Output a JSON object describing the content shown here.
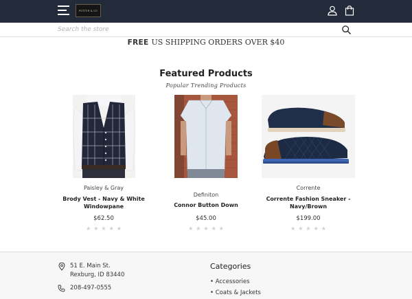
{
  "header": {
    "logo_text": "POTTER & CO",
    "menu_icon": "hamburger-menu-icon",
    "account_icon": "user-icon",
    "cart_icon": "shopping-bag-icon",
    "background_color": "#232b3b"
  },
  "search": {
    "placeholder": "Search the store",
    "icon": "search-icon"
  },
  "promo": {
    "bold": "FREE",
    "text": "US SHIPPING ORDERS OVER $40"
  },
  "featured": {
    "title": "Featured Products",
    "subtitle": "Popular Trending Products",
    "products": [
      {
        "brand": "Paisley & Gray",
        "name_line1": "Brody Vest - Navy & White",
        "name_line2": "Windowpane",
        "price": "$62.50",
        "rating": 0,
        "max_rating": 5
      },
      {
        "brand": "Definiton",
        "name_line1": "Connor Button Down",
        "name_line2": "",
        "price": "$45.00",
        "rating": 0,
        "max_rating": 5
      },
      {
        "brand": "Corrente",
        "name_line1": "Corrente Fashion Sneaker -",
        "name_line2": "Navy/Brown",
        "price": "$199.00",
        "rating": 0,
        "max_rating": 5
      }
    ]
  },
  "footer": {
    "address_line1": "51 E. Main St.",
    "address_line2": "Rexburg, ID 83440",
    "phone": "208-497-0555",
    "categories_title": "Categories",
    "categories": [
      "Accessories",
      "Coats & Jackets"
    ]
  }
}
